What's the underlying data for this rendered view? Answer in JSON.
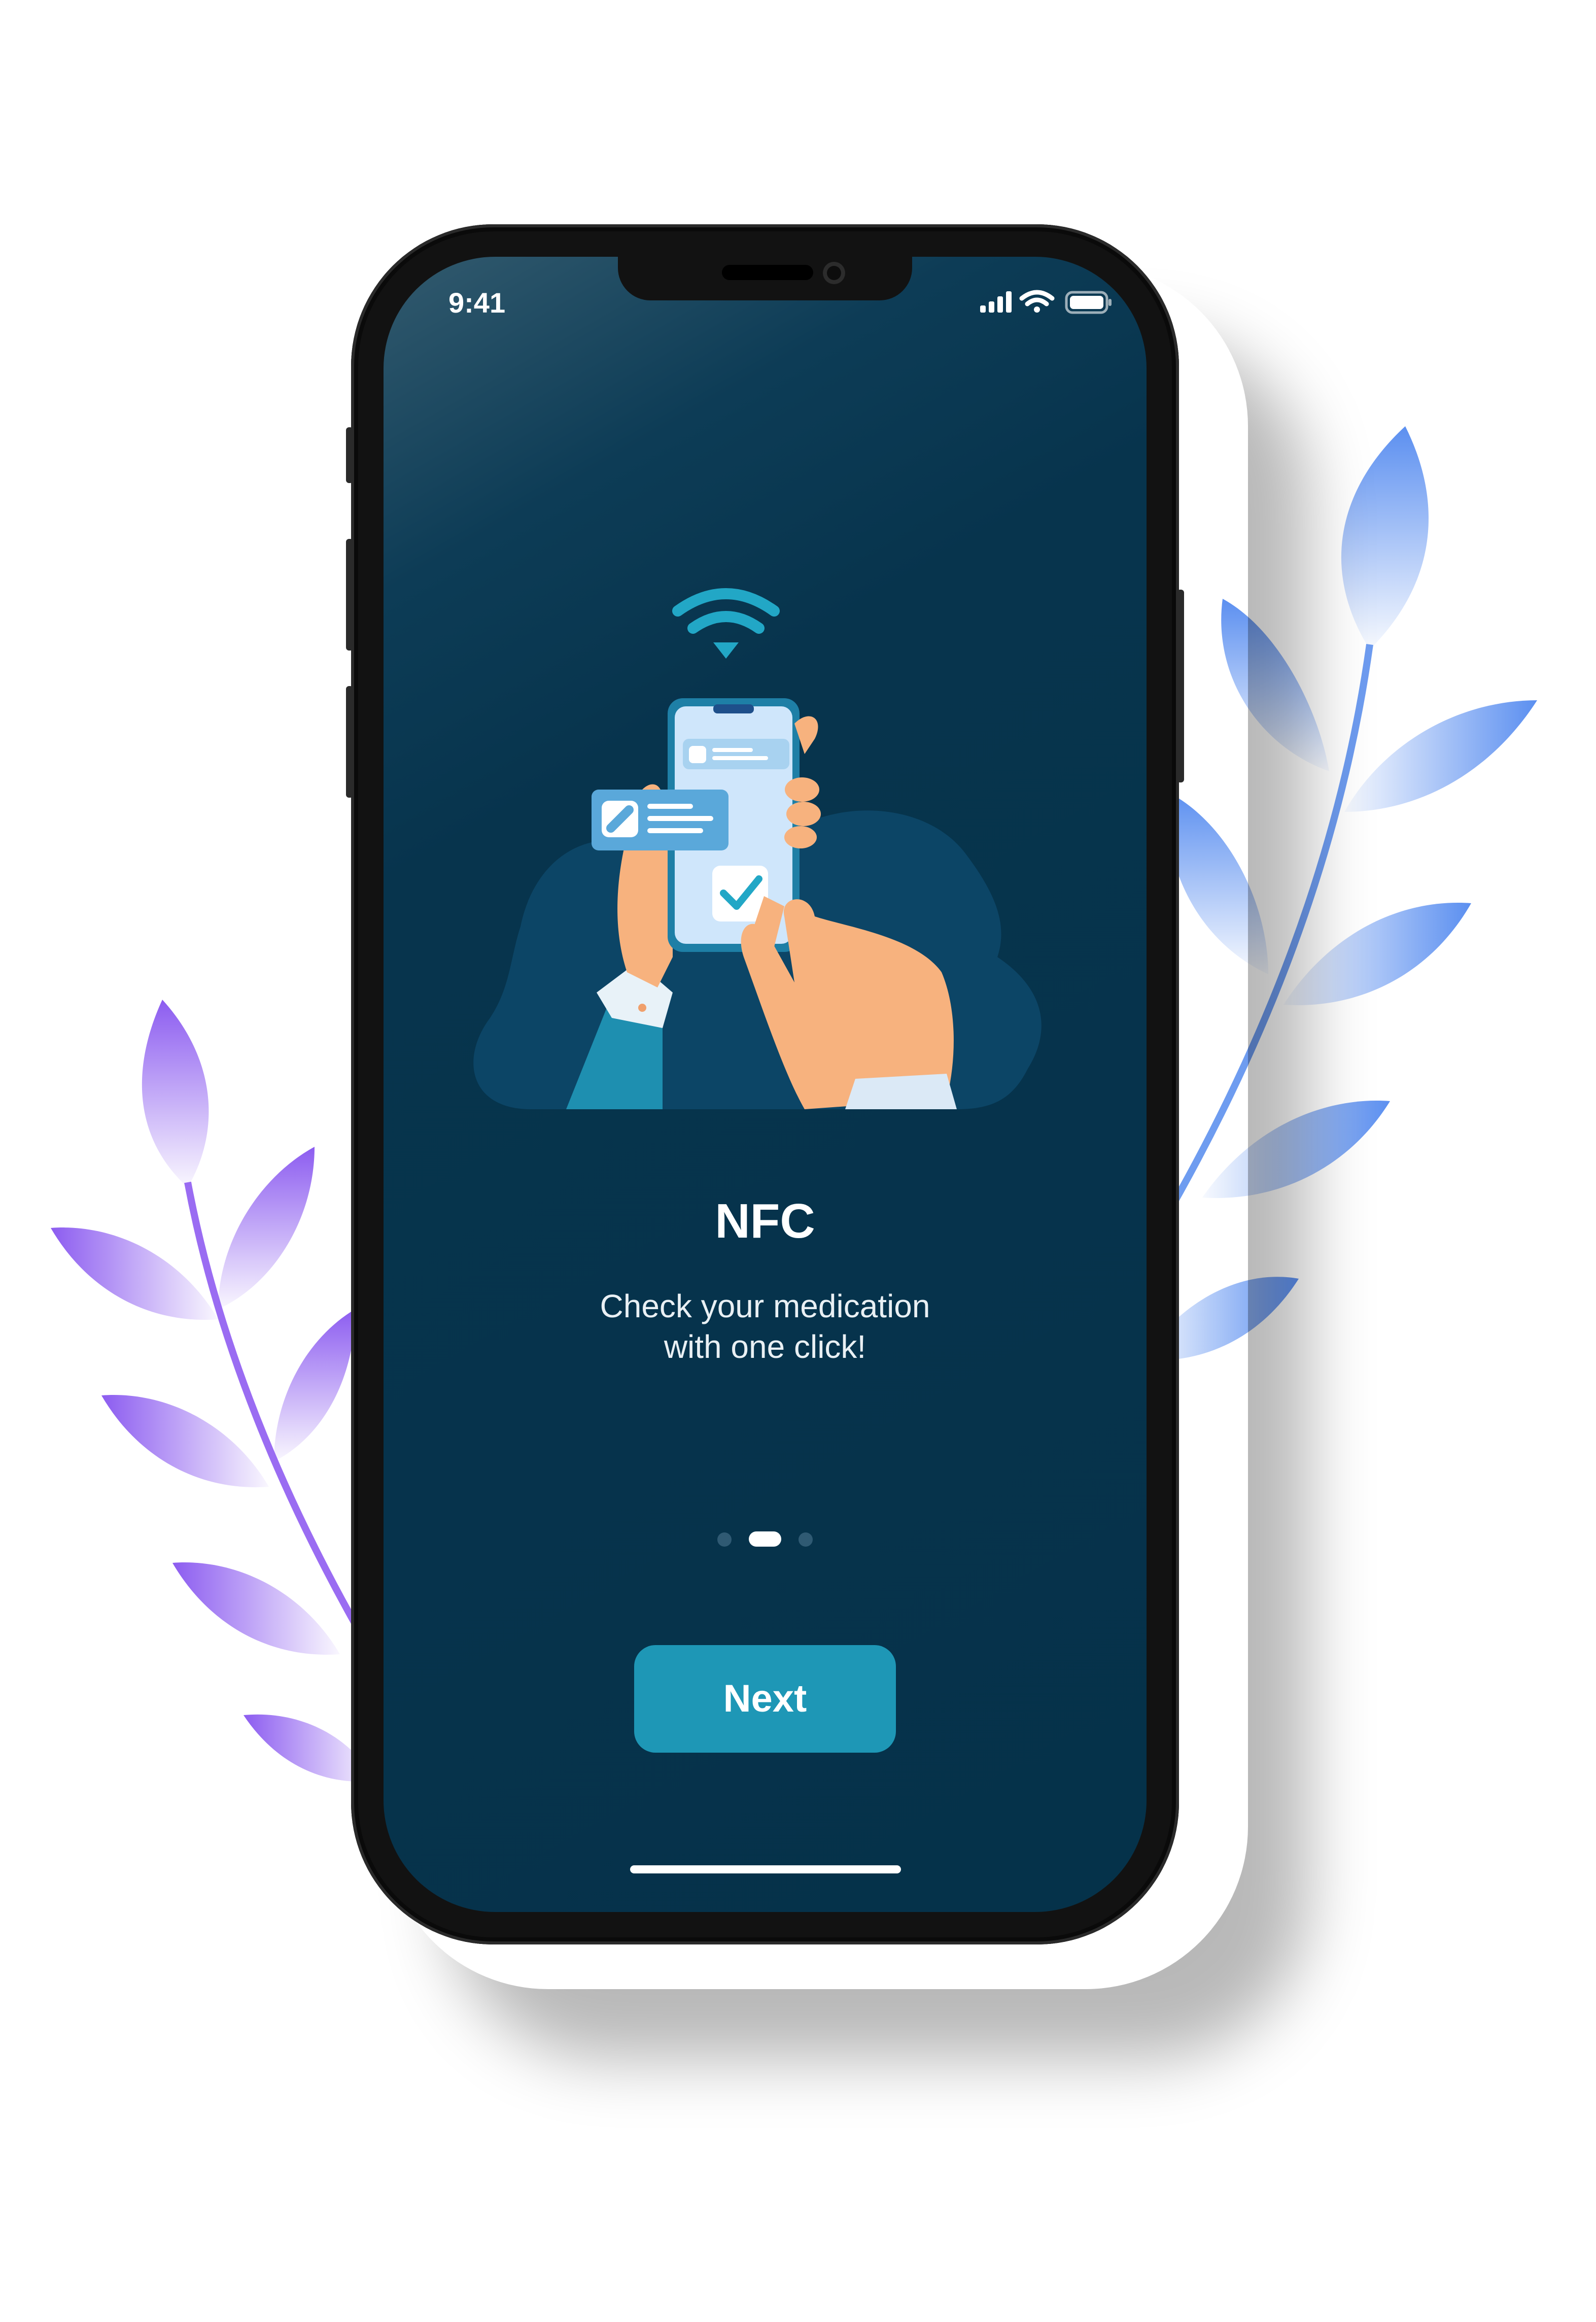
{
  "status_bar": {
    "time": "9:41",
    "icons": [
      "cellular-signal-icon",
      "wifi-icon",
      "battery-icon"
    ]
  },
  "onboarding": {
    "illustration": "nfc-phone-scan-illustration",
    "title": "NFC",
    "subtitle_line1": "Check your medication",
    "subtitle_line2": "with one click!",
    "page_count": 3,
    "current_page": 2
  },
  "actions": {
    "next_label": "Next"
  },
  "colors": {
    "screen_background": "#05324a",
    "accent": "#1e97b6",
    "leaf_purple": "#8c5cf0",
    "leaf_blue": "#5b8ff0"
  }
}
